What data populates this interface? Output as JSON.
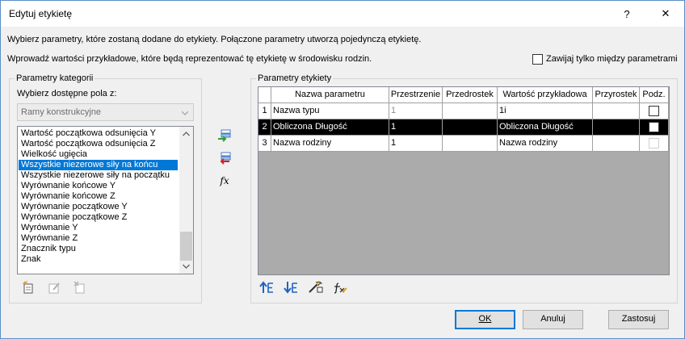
{
  "window": {
    "title": "Edytuj etykietę",
    "help_label": "?",
    "close_label": "✕"
  },
  "instructions": {
    "line1": "Wybierz parametry, które zostaną dodane do etykiety. Połączone parametry utworzą pojedynczą etykietę.",
    "line2": "Wprowadź wartości przykładowe, które będą reprezentować tę etykietę w środowisku rodzin."
  },
  "wrap_checkbox": {
    "label": "Zawijaj tylko między parametrami",
    "checked": false
  },
  "left_group": {
    "title": "Parametry kategorii",
    "select_label": "Wybierz dostępne pola z:",
    "combo_value": "Ramy konstrukcyjne",
    "items": [
      {
        "label": "Wartość początkowa odsunięcia Y"
      },
      {
        "label": "Wartość początkowa odsunięcia Z"
      },
      {
        "label": "Wielkość ugięcia"
      },
      {
        "label": "Wszystkie niezerowe siły na końcu",
        "selected": true
      },
      {
        "label": "Wszystkie niezerowe siły na początku"
      },
      {
        "label": "Wyrównanie końcowe Y"
      },
      {
        "label": "Wyrównanie końcowe Z"
      },
      {
        "label": "Wyrównanie początkowe Y"
      },
      {
        "label": "Wyrównanie początkowe Z"
      },
      {
        "label": "Wyrównanie Y"
      },
      {
        "label": "Wyrównanie Z"
      },
      {
        "label": "Znacznik typu"
      },
      {
        "label": "Znak"
      }
    ],
    "toolbar_icons": [
      "new-parameter-icon",
      "edit-parameter-icon",
      "delete-parameter-icon"
    ]
  },
  "transfer_icons": [
    "add-parameter-icon",
    "remove-parameter-icon",
    "fx-icon"
  ],
  "fx_glyph": "fx",
  "right_group": {
    "title": "Parametry etykiety",
    "columns": [
      "Nazwa parametru",
      "Przestrzenie",
      "Przedrostek",
      "Wartość przykładowa",
      "Przyrostek",
      "Podz."
    ],
    "rows": [
      {
        "num": "1",
        "name": "Nazwa typu",
        "spaces": "1",
        "prefix": "",
        "sample": "1i",
        "suffix": "",
        "split": false,
        "selected": false,
        "spaces_gray": true
      },
      {
        "num": "2",
        "name": "Obliczona Długość",
        "spaces": "1",
        "prefix": "",
        "sample": "Obliczona Długość",
        "suffix": "",
        "split": false,
        "selected": true,
        "spaces_gray": false
      },
      {
        "num": "3",
        "name": "Nazwa rodziny",
        "spaces": "1",
        "prefix": "",
        "sample": "Nazwa rodziny",
        "suffix": "",
        "split": false,
        "selected": false,
        "spaces_gray": false
      }
    ],
    "toolbar_icons": [
      "move-up-icon",
      "move-down-icon",
      "edit-format-icon",
      "edit-formula-icon"
    ]
  },
  "buttons": {
    "ok": "OK",
    "cancel": "Anuluj",
    "apply": "Zastosuj"
  }
}
